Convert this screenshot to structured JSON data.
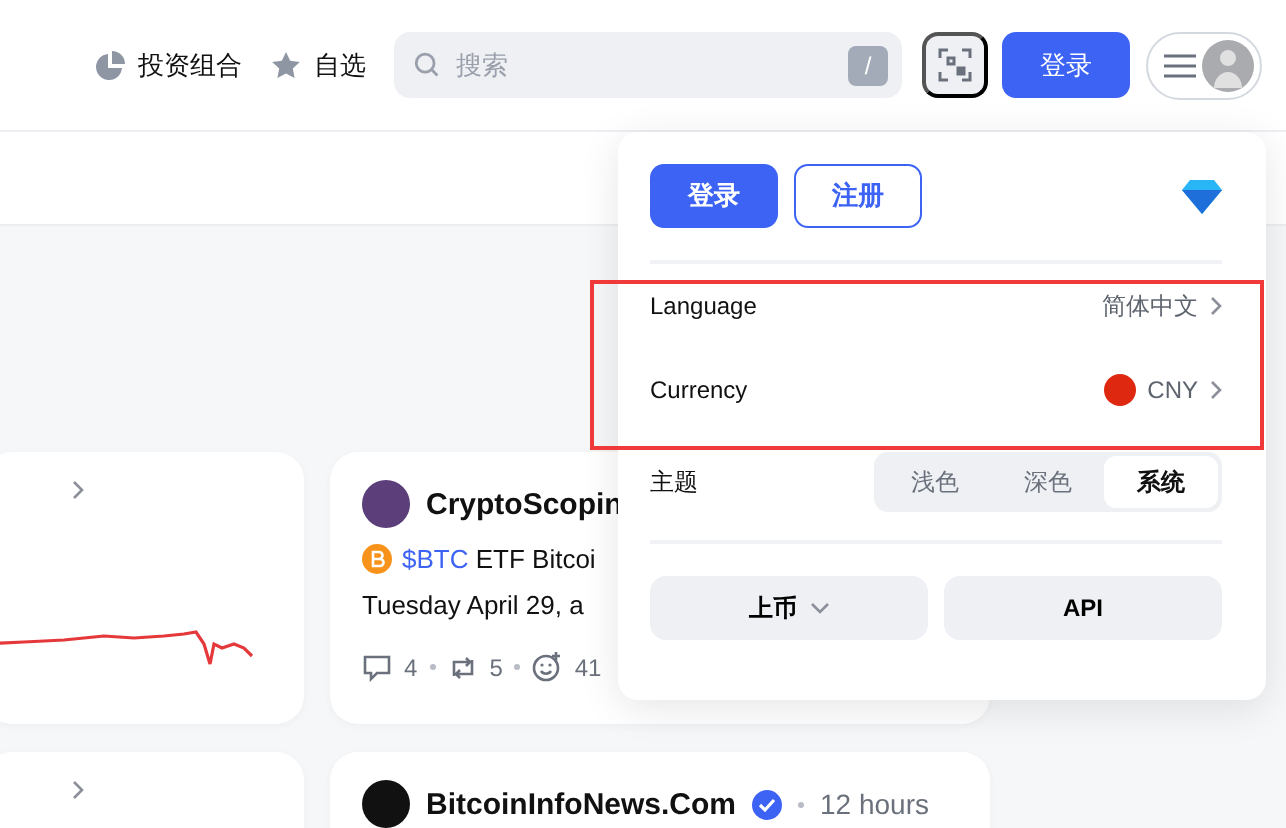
{
  "header": {
    "nav": [
      {
        "label": "投资组合",
        "kind": "portfolio"
      },
      {
        "label": "自选",
        "kind": "watchlist"
      }
    ],
    "search": {
      "placeholder": "搜索",
      "shortcut": "/"
    },
    "login_button": "登录"
  },
  "posts": [
    {
      "author": "CryptoScopin",
      "ticker": "$BTC",
      "text": "ETF Bitcoi",
      "text_line_2": "Tuesday April 29, a",
      "comments": "4",
      "reposts": "5",
      "reactions": "41"
    },
    {
      "author": "BitcoinInfoNews.Com",
      "verified": true,
      "time": "12 hours"
    }
  ],
  "menu": {
    "buttons": [
      {
        "label": "登录",
        "kind": "primary"
      },
      {
        "label": "注册",
        "kind": "outline"
      }
    ],
    "settings": [
      {
        "label": "Language",
        "value": "简体中文",
        "kind": "language"
      },
      {
        "label": "Currency",
        "value": "CNY",
        "kind": "currency"
      }
    ],
    "theme": {
      "label": "主题",
      "options": [
        {
          "label": "浅色",
          "selected": false
        },
        {
          "label": "深色",
          "selected": false
        },
        {
          "label": "系统",
          "selected": true
        }
      ]
    },
    "footer_buttons": [
      {
        "label": "上币",
        "kind": "dropdown"
      },
      {
        "label": "API",
        "kind": "plain"
      }
    ]
  }
}
